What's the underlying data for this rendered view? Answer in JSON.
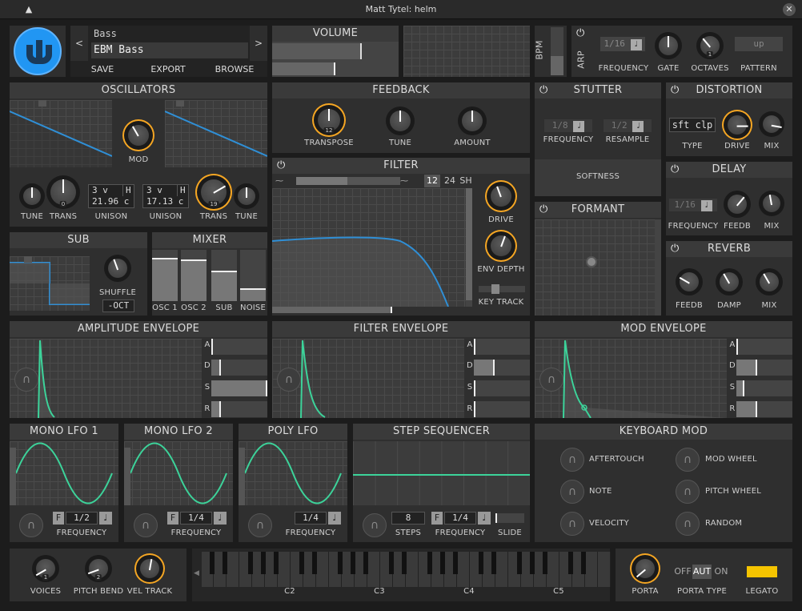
{
  "window": {
    "title": "Matt Tytel: helm"
  },
  "patch": {
    "category": "Bass",
    "name": "EBM Bass",
    "prev": "<",
    "next": ">",
    "save": "SAVE",
    "export": "EXPORT",
    "browse": "BROWSE"
  },
  "volume": {
    "title": "VOLUME"
  },
  "bpm": {
    "label": "BPM"
  },
  "arp": {
    "label": "ARP",
    "frequency_value": "1/16",
    "frequency": "FREQUENCY",
    "gate": "GATE",
    "octaves": "OCTAVES",
    "octaves_value": "1",
    "pattern": "PATTERN",
    "pattern_value": "up"
  },
  "osc": {
    "title": "OSCILLATORS",
    "mod": "MOD",
    "tune": "TUNE",
    "trans": "TRANS",
    "trans_val": "0",
    "trans2_val": "19",
    "unison": "UNISON",
    "u1_voices": "3 v",
    "u1_h": "H",
    "u1_cents": "21.96 c",
    "u2_voices": "3 v",
    "u2_h": "H",
    "u2_cents": "17.13 c"
  },
  "feedback": {
    "title": "FEEDBACK",
    "transpose": "TRANSPOSE",
    "transpose_val": "12",
    "tune": "TUNE",
    "amount": "AMOUNT"
  },
  "filter": {
    "title": "FILTER",
    "db12": "12",
    "db24": "24",
    "sh": "SH",
    "drive": "DRIVE",
    "env_depth": "ENV DEPTH",
    "key_track": "KEY TRACK"
  },
  "sub": {
    "title": "SUB",
    "shuffle": "SHUFFLE",
    "octave": "-OCT"
  },
  "mixer": {
    "title": "MIXER",
    "osc1": "OSC 1",
    "osc2": "OSC 2",
    "sub": "SUB",
    "noise": "NOISE",
    "levels": [
      0.85,
      0.82,
      0.6,
      0.25
    ]
  },
  "stutter": {
    "title": "STUTTER",
    "freq_val": "1/8",
    "resample_val": "1/2",
    "frequency": "FREQUENCY",
    "resample": "RESAMPLE",
    "softness": "SOFTNESS"
  },
  "formant": {
    "title": "FORMANT"
  },
  "distortion": {
    "title": "DISTORTION",
    "type_val": "sft clp",
    "type": "TYPE",
    "drive": "DRIVE",
    "mix": "MIX"
  },
  "delay": {
    "title": "DELAY",
    "freq_val": "1/16",
    "frequency": "FREQUENCY",
    "feedb": "FEEDB",
    "mix": "MIX"
  },
  "reverb": {
    "title": "REVERB",
    "feedb": "FEEDB",
    "damp": "DAMP",
    "mix": "MIX"
  },
  "envs": {
    "amp": "AMPLITUDE ENVELOPE",
    "filter": "FILTER ENVELOPE",
    "mod": "MOD ENVELOPE",
    "a": "A",
    "d": "D",
    "s": "S",
    "r": "R"
  },
  "lfo1": {
    "title": "MONO LFO 1",
    "f": "F",
    "value": "1/2",
    "frequency": "FREQUENCY"
  },
  "lfo2": {
    "title": "MONO LFO 2",
    "f": "F",
    "value": "1/4",
    "frequency": "FREQUENCY"
  },
  "polylfo": {
    "title": "POLY LFO",
    "value": "1/4",
    "frequency": "FREQUENCY"
  },
  "seq": {
    "title": "STEP SEQUENCER",
    "steps_val": "8",
    "steps": "STEPS",
    "f": "F",
    "freq_val": "1/4",
    "frequency": "FREQUENCY",
    "slide": "SLIDE"
  },
  "kbmod": {
    "title": "KEYBOARD MOD",
    "aftertouch": "AFTERTOUCH",
    "mod_wheel": "MOD WHEEL",
    "note": "NOTE",
    "pitch_wheel": "PITCH WHEEL",
    "velocity": "VELOCITY",
    "random": "RANDOM"
  },
  "bottom": {
    "voices": "VOICES",
    "voices_val": "1",
    "pitch_bend": "PITCH BEND",
    "pitch_bend_val": "2",
    "vel_track": "VEL TRACK",
    "porta": "PORTA",
    "porta_type": "PORTA TYPE",
    "off": "OFF",
    "aut": "AUT",
    "on": "ON",
    "legato": "LEGATO"
  },
  "keyboard": {
    "c2": "C2",
    "c3": "C3",
    "c4": "C4",
    "c5": "C5"
  },
  "colors": {
    "accent": "#f5a623",
    "wave": "#2f8fd6",
    "env": "#3cd39a",
    "legato": "#f5c400"
  }
}
